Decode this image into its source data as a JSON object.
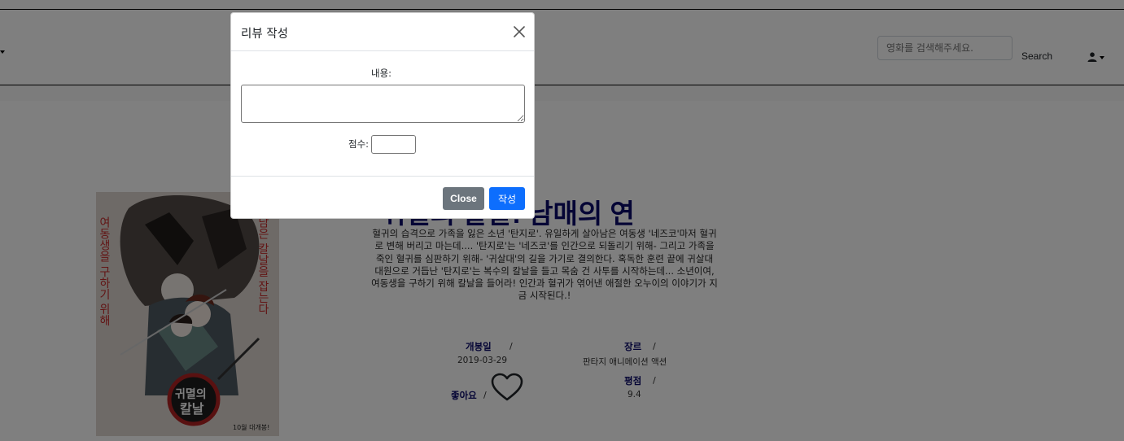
{
  "navbar": {
    "search_placeholder": "영화를 검색해주세요.",
    "search_button": "Search"
  },
  "movie": {
    "title": "귀멸의 칼날: 남매의 연",
    "synopsis": "혈귀의 습격으로 가족을 잃은 소년 '탄지로'. 유일하게 살아남은 여동생 '네즈코'마저 혈귀로 변해 버리고 마는데.... '탄지로'는 '네즈코'를 인간으로 되돌리기 위해- 그리고 가족을 죽인 혈귀를 심판하기 위해- '귀살대'의 길을 가기로 결의한다. 혹독한 훈련 끝에 귀살대 대원으로 거듭난 '탄지로'는 복수의 칼날을 들고 목숨 건 사투를 시작하는데... 소년이여, 여동생을 구하기 위해 칼날을 들어라! 인간과 혈귀가 엮어낸 애절한 오누이의 이야기가 지금 시작된다.!",
    "release_label": "개봉일",
    "release_date": "2019-03-29",
    "genre_label": "장르",
    "genres": "판타지 애니메이션 액션",
    "like_label": "좋아요",
    "rating_label": "평점",
    "rating": "9.4",
    "slash": "/"
  },
  "poster": {
    "tagline_left": "여동생을 구하기 위해",
    "tagline_right": "남은 칼날을 잡는다",
    "logo_line1": "귀멸의",
    "logo_line2": "칼날",
    "release_note": "10월 대개봉!"
  },
  "modal": {
    "title": "리뷰 작성",
    "content_label": "내용:",
    "score_label": "점수:",
    "close_button": "Close",
    "submit_button": "작성"
  },
  "colors": {
    "accent_navy": "#0b0b6b",
    "primary_button": "#0d6efd",
    "secondary_button": "#6c757d"
  },
  "icons": {
    "close": "close-icon",
    "user": "user-icon",
    "like": "heart-icon"
  }
}
